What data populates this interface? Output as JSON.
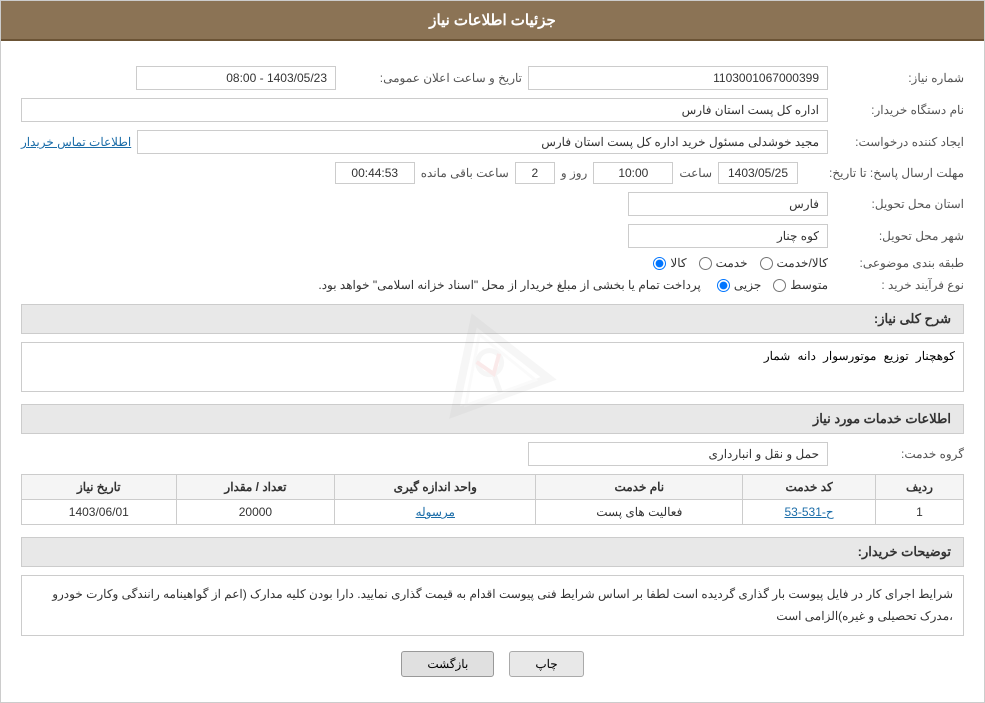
{
  "header": {
    "title": "جزئیات اطلاعات نیاز"
  },
  "fields": {
    "shomara_niaz_label": "شماره نیاز:",
    "shomara_niaz_value": "1103001067000399",
    "nam_dastgah_label": "نام دستگاه خریدار:",
    "nam_dastgah_value": "اداره کل پست استان فارس",
    "ijad_konande_label": "ایجاد کننده درخواست:",
    "ijad_konande_value": "مجید خوشدلی مسئول خرید اداره کل پست استان فارس",
    "tamaas_link": "اطلاعات تماس خریدار",
    "mohlat_label": "مهلت ارسال پاسخ: تا تاریخ:",
    "mohlat_date": "1403/05/25",
    "mohlat_saat_label": "ساعت",
    "mohlat_saat": "10:00",
    "mohlat_rooz_label": "روز و",
    "mohlat_rooz": "2",
    "mohlat_baqi_label": "ساعت باقی مانده",
    "mohlat_baqi": "00:44:53",
    "tarikh_label": "تاریخ و ساعت اعلان عمومی:",
    "tarikh_value": "1403/05/23 - 08:00",
    "ostan_label": "استان محل تحویل:",
    "ostan_value": "فارس",
    "shahr_label": "شهر محل تحویل:",
    "shahr_value": "کوه چنار",
    "tabaqe_label": "طبقه بندی موضوعی:",
    "tabaqe_kala": "کالا",
    "tabaqe_khadamat": "خدمت",
    "tabaqe_kala_khadamat": "کالا/خدمت",
    "type_label": "نوع فرآیند خرید :",
    "type_jozi": "جزیی",
    "type_motavaset": "متوسط",
    "type_notice": "پرداخت تمام یا بخشی از مبلغ خریدار از محل \"اسناد خزانه اسلامی\" خواهد بود.",
    "sharh_label": "شرح کلی نیاز:",
    "sharh_value": "کوهچنار توزیع موتورسوار دانه شمار",
    "services_title": "اطلاعات خدمات مورد نیاز",
    "group_label": "گروه خدمت:",
    "group_value": "حمل و نقل و انبارداری"
  },
  "table": {
    "headers": [
      "ردیف",
      "کد خدمت",
      "نام خدمت",
      "واحد اندازه گیری",
      "تعداد / مقدار",
      "تاریخ نیاز"
    ],
    "rows": [
      {
        "radif": "1",
        "code": "ح-531-53",
        "name": "فعالیت های پست",
        "unit": "مرسوله",
        "count": "20000",
        "date": "1403/06/01"
      }
    ]
  },
  "buyer_desc_label": "توضیحات خریدار:",
  "buyer_desc_value": "شرایط اجرای کار در فایل پیوست بار گذاری گردیده است لطفا بر اساس شرایط فنی پیوست اقدام به قیمت گذاری نمایید.\nدارا بودن کلیه مدارک (اعم از گواهینامه رانندگی وکارت خودرو ،مدرک تحصیلی و غیره)الزامی است",
  "buttons": {
    "back": "بازگشت",
    "print": "چاپ"
  }
}
